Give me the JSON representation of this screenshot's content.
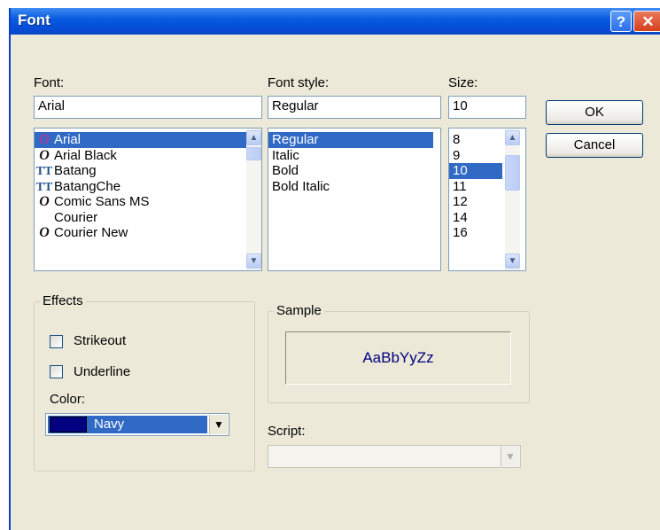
{
  "window": {
    "title": "Font"
  },
  "titlebar": {
    "help_glyph": "?",
    "close_glyph": "✕"
  },
  "font": {
    "label": "Font:",
    "value": "Arial",
    "items": [
      {
        "name": "Arial",
        "icon": "O",
        "selected": true
      },
      {
        "name": "Arial Black",
        "icon": "O"
      },
      {
        "name": "Batang",
        "icon": "TT"
      },
      {
        "name": "BatangChe",
        "icon": "TT"
      },
      {
        "name": "Comic Sans MS",
        "icon": "O"
      },
      {
        "name": "Courier",
        "icon": ""
      },
      {
        "name": "Courier New",
        "icon": "O"
      }
    ]
  },
  "font_style": {
    "label": "Font style:",
    "value": "Regular",
    "items": [
      "Regular",
      "Italic",
      "Bold",
      "Bold Italic"
    ]
  },
  "size": {
    "label": "Size:",
    "value": "10",
    "items": [
      "8",
      "9",
      "10",
      "11",
      "12",
      "14",
      "16"
    ]
  },
  "buttons": {
    "ok": "OK",
    "cancel": "Cancel"
  },
  "effects": {
    "label": "Effects",
    "strikeout": "Strikeout",
    "underline": "Underline",
    "color_label": "Color:",
    "color_value": "Navy",
    "color_hex": "#000080"
  },
  "sample": {
    "label": "Sample",
    "text": "AaBbYyZz",
    "color": "#000080"
  },
  "script": {
    "label": "Script:",
    "value": ""
  },
  "colors": {
    "selection": "#316ac5",
    "titlebar": "#0550d8",
    "dialog_bg": "#ece9d8"
  }
}
